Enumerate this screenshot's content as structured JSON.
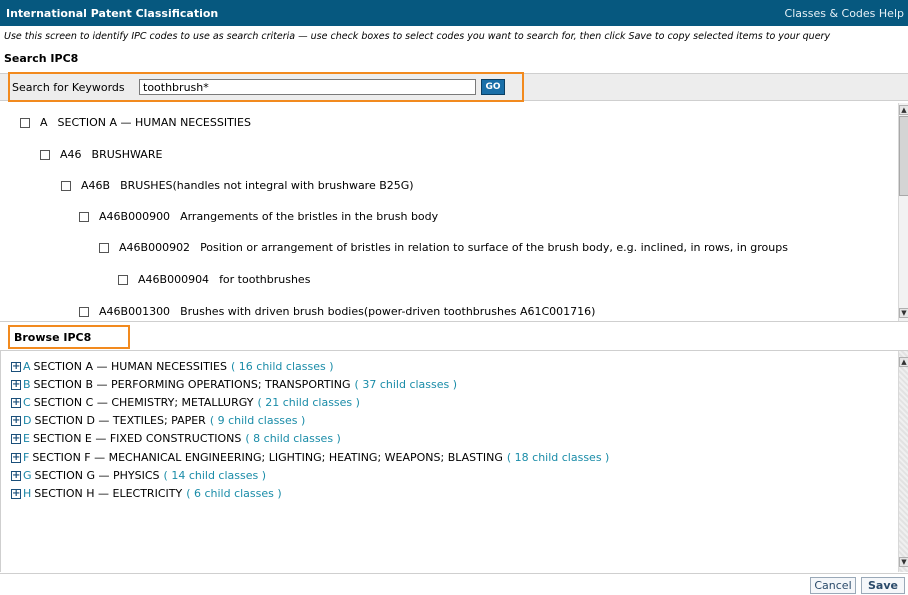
{
  "window": {
    "title": "International Patent Classification",
    "help_link": "Classes & Codes Help"
  },
  "instructions": "Use this screen to identify IPC codes to use as search criteria — use check boxes to select codes you want to search for, then click Save to copy selected items to your query",
  "search": {
    "heading": "Search IPC8",
    "label": "Search for Keywords",
    "value": "toothbrush*",
    "go_label": "GO"
  },
  "results": [
    {
      "code": "A",
      "text": "SECTION A — HUMAN NECESSITIES",
      "checked": false
    },
    {
      "code": "A46",
      "text": "BRUSHWARE",
      "checked": false
    },
    {
      "code": "A46B",
      "text": "BRUSHES(handles not integral with brushware B25G)",
      "checked": false
    },
    {
      "code": "A46B000900",
      "text": "Arrangements of the bristles in the brush body",
      "checked": false
    },
    {
      "code": "A46B000902",
      "text": "Position or arrangement of bristles in relation to surface of the brush body, e.g. inclined, in rows, in groups",
      "checked": false
    },
    {
      "code": "A46B000904",
      "text": "for toothbrushes",
      "checked": false
    },
    {
      "code": "A46B001300",
      "text": "Brushes with driven brush bodies(power-driven toothbrushes A61C001716)",
      "checked": false
    }
  ],
  "browse": {
    "heading": "Browse IPC8",
    "sections": [
      {
        "letter": "A",
        "text": "SECTION A — HUMAN NECESSITIES",
        "children": "( 16 child classes )"
      },
      {
        "letter": "B",
        "text": "SECTION B — PERFORMING OPERATIONS; TRANSPORTING",
        "children": "( 37 child classes )"
      },
      {
        "letter": "C",
        "text": "SECTION C — CHEMISTRY; METALLURGY",
        "children": "( 21 child classes )"
      },
      {
        "letter": "D",
        "text": "SECTION D — TEXTILES; PAPER",
        "children": "( 9 child classes )"
      },
      {
        "letter": "E",
        "text": "SECTION E — FIXED CONSTRUCTIONS",
        "children": "( 8 child classes )"
      },
      {
        "letter": "F",
        "text": "SECTION F — MECHANICAL ENGINEERING; LIGHTING; HEATING; WEAPONS; BLASTING",
        "children": "( 18 child classes )"
      },
      {
        "letter": "G",
        "text": "SECTION G — PHYSICS",
        "children": "( 14 child classes )"
      },
      {
        "letter": "H",
        "text": "SECTION H — ELECTRICITY",
        "children": "( 6 child classes )"
      }
    ]
  },
  "footer": {
    "cancel_label": "Cancel",
    "save_label": "Save"
  },
  "colors": {
    "titlebar": "#06587f",
    "highlight": "#f28a1e",
    "link": "#1a8ca8"
  }
}
